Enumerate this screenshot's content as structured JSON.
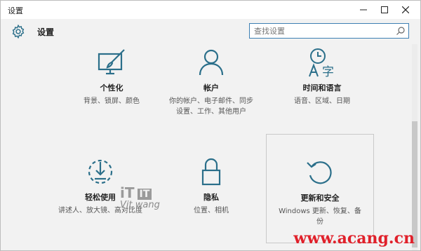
{
  "window": {
    "title": "设置"
  },
  "header": {
    "title": "设置"
  },
  "search": {
    "placeholder": "查找设置"
  },
  "tiles": [
    {
      "name": "个性化",
      "desc": "背景、锁屏、颜色",
      "icon": "personalization-icon"
    },
    {
      "name": "帐户",
      "desc": "你的帐户、电子邮件、同步设置、工作、其他用户",
      "icon": "account-icon"
    },
    {
      "name": "时间和语言",
      "desc": "语音、区域、日期",
      "icon": "time-language-icon"
    },
    {
      "name": "轻松使用",
      "desc": "讲述人、放大镜、高对比度",
      "icon": "ease-of-access-icon"
    },
    {
      "name": "隐私",
      "desc": "位置、相机",
      "icon": "privacy-lock-icon"
    },
    {
      "name": "更新和安全",
      "desc": "Windows 更新、恢复、备份",
      "icon": "update-icon"
    }
  ],
  "watermark": {
    "brand": "iT",
    "box": "IT",
    "sub": "Vit.wang",
    "site": "www.acang.cn"
  },
  "colors": {
    "accent": "#2b6f8a",
    "search_border": "#3d7fb3",
    "watermark_red": "#e0202a"
  }
}
